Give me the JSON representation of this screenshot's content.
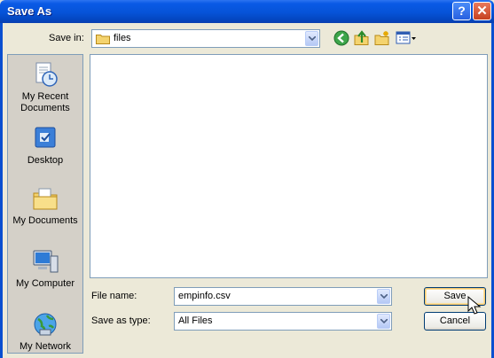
{
  "window": {
    "title": "Save As",
    "help_label": "?",
    "close_label": "✕"
  },
  "toolbar": {
    "save_in_label": "Save in:",
    "save_in_value": "files",
    "icons": [
      "back-icon",
      "up-folder-icon",
      "new-folder-icon",
      "views-menu-icon"
    ]
  },
  "places": [
    {
      "label": "My Recent Documents",
      "icon": "recent-documents-icon"
    },
    {
      "label": "Desktop",
      "icon": "desktop-icon"
    },
    {
      "label": "My Documents",
      "icon": "my-documents-icon"
    },
    {
      "label": "My Computer",
      "icon": "my-computer-icon"
    },
    {
      "label": "My Network",
      "icon": "network-icon"
    }
  ],
  "form": {
    "file_name_label": "File name:",
    "file_name_value": "empinfo.csv",
    "save_as_type_label": "Save as type:",
    "save_as_type_value": "All Files"
  },
  "buttons": {
    "save_label": "Save",
    "cancel_label": "Cancel"
  },
  "colors": {
    "titlebar": "#0653D8",
    "dialog_bg": "#ECE9D8",
    "places_bg": "#D4D0C8",
    "focus_ring": "#F3C770"
  }
}
